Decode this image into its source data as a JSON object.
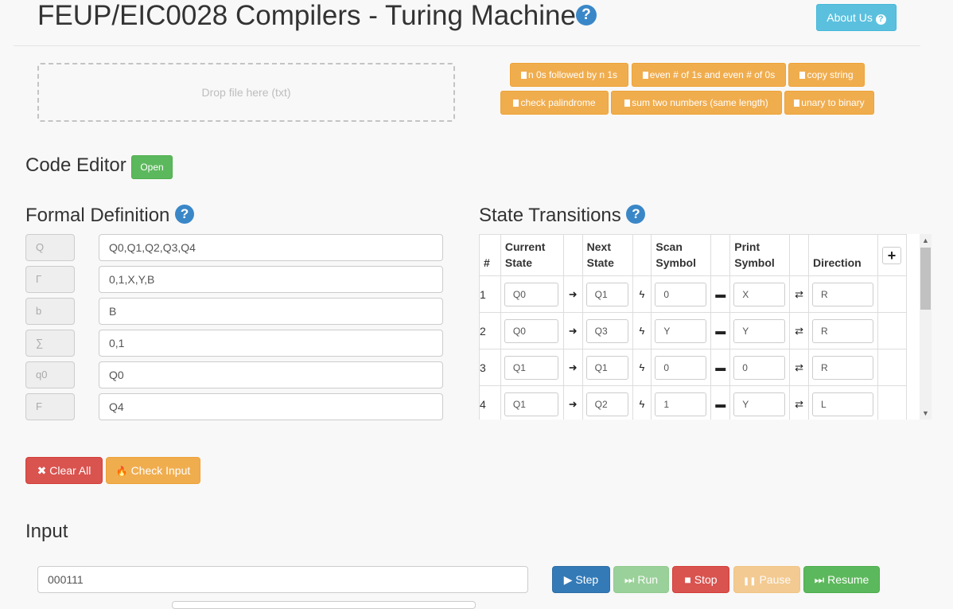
{
  "header": {
    "title": "FEUP/EIC0028 Compilers - Turing Machine",
    "help_icon": "?",
    "about_label": "About Us",
    "about_icon": "?"
  },
  "dropzone": {
    "text": "Drop file here (txt)"
  },
  "examples": [
    "n 0s followed by n 1s",
    "even # of 1s and even # of 0s",
    "copy string",
    "check palindrome",
    "sum two numbers (same length)",
    "unary to binary"
  ],
  "code_editor": {
    "heading": "Code Editor",
    "open_label": "Open"
  },
  "formal_definition": {
    "heading": "Formal Definition",
    "help_icon": "?",
    "rows": [
      {
        "label": "Q",
        "value": "Q0,Q1,Q2,Q3,Q4"
      },
      {
        "label": "Γ",
        "value": "0,1,X,Y,B"
      },
      {
        "label": "b",
        "value": "B"
      },
      {
        "label": "∑",
        "value": "0,1"
      },
      {
        "label": "q0",
        "value": "Q0"
      },
      {
        "label": "F",
        "value": "Q4"
      }
    ]
  },
  "state_transitions": {
    "heading": "State Transitions",
    "help_icon": "?",
    "columns": {
      "num": "#",
      "current_line1": "Current",
      "current_line2": "State",
      "next_line1": "Next",
      "next_line2": "State",
      "scan_line1": "Scan",
      "scan_line2": "Symbol",
      "print_line1": "Print",
      "print_line2": "Symbol",
      "direction": "Direction",
      "add": "+"
    },
    "symbols": {
      "arrow": "➜",
      "bolt": "ϟ",
      "dash": "▬",
      "swap": "⇄"
    },
    "rows": [
      {
        "n": "1",
        "current": "Q0",
        "next": "Q1",
        "scan": "0",
        "print": "X",
        "dir": "R"
      },
      {
        "n": "2",
        "current": "Q0",
        "next": "Q3",
        "scan": "Y",
        "print": "Y",
        "dir": "R"
      },
      {
        "n": "3",
        "current": "Q1",
        "next": "Q1",
        "scan": "0",
        "print": "0",
        "dir": "R"
      },
      {
        "n": "4",
        "current": "Q1",
        "next": "Q2",
        "scan": "1",
        "print": "Y",
        "dir": "L"
      }
    ]
  },
  "actions": {
    "clear_icon": "✖",
    "clear_label": "Clear All",
    "check_icon": "🔥",
    "check_label": "Check Input"
  },
  "input_section": {
    "heading": "Input",
    "value": "000111"
  },
  "controls": {
    "step_icon": "▶",
    "step_label": "Step",
    "run_icon": "⏭",
    "run_label": "Run",
    "stop_icon": "■",
    "stop_label": "Stop",
    "pause_icon": "❚❚",
    "pause_label": "Pause",
    "resume_icon": "⏭",
    "resume_label": "Resume"
  },
  "colors": {
    "info": "#5bc0de",
    "warning": "#f0ad4e",
    "success": "#5cb85c",
    "danger": "#d9534f",
    "primary": "#337ab7",
    "help": "#3a87c8"
  },
  "icons": {
    "help": "question-circle-icon",
    "file": "file-icon",
    "clear": "times-icon",
    "check": "fire-icon",
    "step": "play-icon",
    "run": "fast-forward-icon",
    "stop": "stop-icon",
    "pause": "pause-icon",
    "resume": "fast-forward-icon"
  }
}
